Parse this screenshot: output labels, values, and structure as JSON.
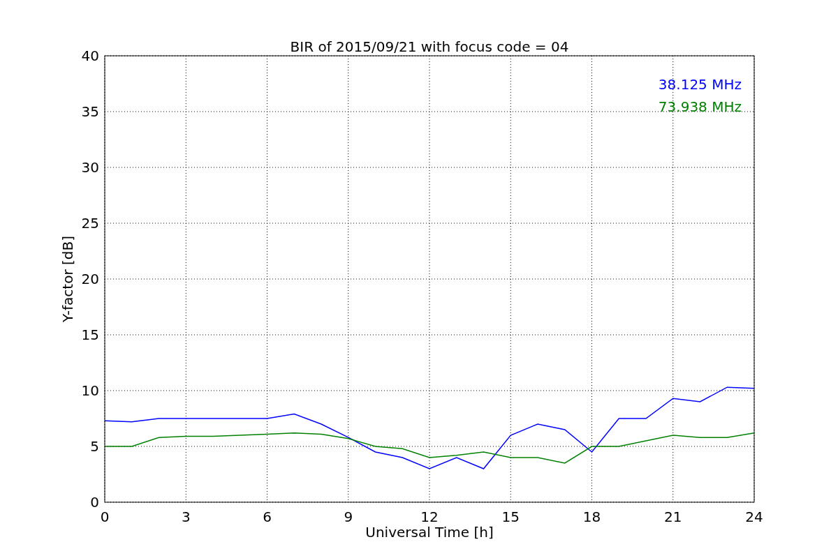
{
  "chart_data": {
    "type": "line",
    "title": "BIR of 2015/09/21 with focus code = 04",
    "xlabel": "Universal Time [h]",
    "ylabel": "Y-factor [dB]",
    "x": [
      0,
      1,
      2,
      3,
      4,
      5,
      6,
      7,
      8,
      9,
      10,
      11,
      12,
      13,
      14,
      15,
      16,
      17,
      18,
      19,
      20,
      21,
      22,
      23,
      24
    ],
    "series": [
      {
        "name": "38.125 MHz",
        "color": "#0000ff",
        "values": [
          7.3,
          7.2,
          7.5,
          7.5,
          7.5,
          7.5,
          7.5,
          7.9,
          7.0,
          5.8,
          4.5,
          4.0,
          3.0,
          4.0,
          3.0,
          6.0,
          7.0,
          6.5,
          4.5,
          7.5,
          7.5,
          9.3,
          9.0,
          10.3,
          10.2
        ]
      },
      {
        "name": "73.938 MHz",
        "color": "#008000",
        "values": [
          5.0,
          5.0,
          5.8,
          5.9,
          5.9,
          6.0,
          6.1,
          6.2,
          6.1,
          5.7,
          5.0,
          4.8,
          4.0,
          4.2,
          4.5,
          4.0,
          4.0,
          3.5,
          5.0,
          5.0,
          5.5,
          6.0,
          5.8,
          5.8,
          6.2
        ]
      }
    ],
    "grid": true,
    "xlim": [
      0,
      24
    ],
    "ylim": [
      0,
      40
    ],
    "xticks": [
      0,
      3,
      6,
      9,
      12,
      15,
      18,
      21,
      24
    ],
    "yticks": [
      0,
      5,
      10,
      15,
      20,
      25,
      30,
      35,
      40
    ]
  }
}
